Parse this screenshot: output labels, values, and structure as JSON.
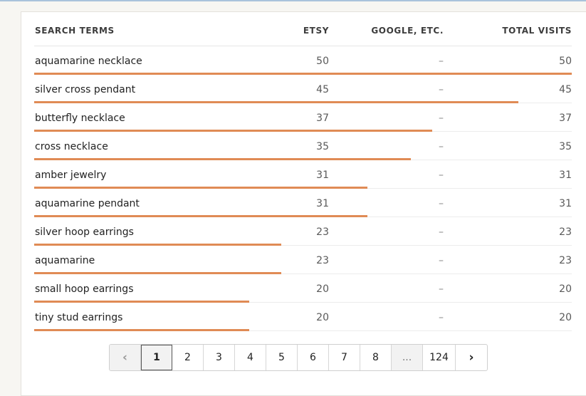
{
  "table": {
    "headers": {
      "term": "SEARCH TERMS",
      "etsy": "ETSY",
      "google": "GOOGLE, ETC.",
      "total": "TOTAL VISITS"
    },
    "max_total": 50,
    "rows": [
      {
        "term": "aquamarine necklace",
        "etsy": "50",
        "google": "–",
        "total": "50",
        "share": 1.0
      },
      {
        "term": "silver cross pendant",
        "etsy": "45",
        "google": "–",
        "total": "45",
        "share": 0.9
      },
      {
        "term": "butterfly necklace",
        "etsy": "37",
        "google": "–",
        "total": "37",
        "share": 0.74
      },
      {
        "term": "cross necklace",
        "etsy": "35",
        "google": "–",
        "total": "35",
        "share": 0.7
      },
      {
        "term": "amber jewelry",
        "etsy": "31",
        "google": "–",
        "total": "31",
        "share": 0.62
      },
      {
        "term": "aquamarine pendant",
        "etsy": "31",
        "google": "–",
        "total": "31",
        "share": 0.62
      },
      {
        "term": "silver hoop earrings",
        "etsy": "23",
        "google": "–",
        "total": "23",
        "share": 0.46
      },
      {
        "term": "aquamarine",
        "etsy": "23",
        "google": "–",
        "total": "23",
        "share": 0.46
      },
      {
        "term": "small hoop earrings",
        "etsy": "20",
        "google": "–",
        "total": "20",
        "share": 0.4
      },
      {
        "term": "tiny stud earrings",
        "etsy": "20",
        "google": "–",
        "total": "20",
        "share": 0.4
      }
    ]
  },
  "pagination": {
    "prev_icon": "chevron-left-icon",
    "next_icon": "chevron-right-icon",
    "prev_glyph": "‹",
    "next_glyph": "›",
    "pages": [
      "1",
      "2",
      "3",
      "4",
      "5",
      "6",
      "7",
      "8"
    ],
    "current": "1",
    "ellipsis": "...",
    "last": "124"
  },
  "colors": {
    "bar": "#e08b55",
    "accent_border": "#a9c3db"
  }
}
